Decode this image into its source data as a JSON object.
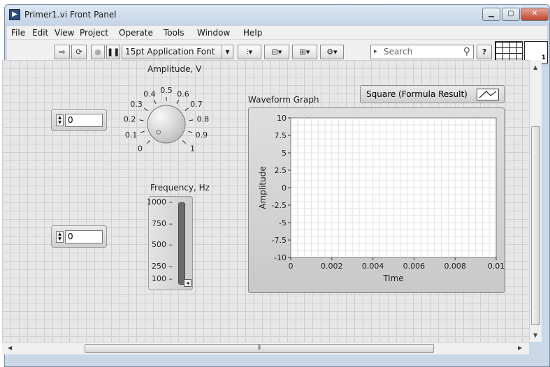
{
  "window": {
    "title": "Primer1.vi Front Panel"
  },
  "menu": [
    "File",
    "Edit",
    "View",
    "Project",
    "Operate",
    "Tools",
    "Window",
    "Help"
  ],
  "toolbar": {
    "font": "15pt Application Font",
    "search_placeholder": "Search",
    "vi_icon_badge": "1"
  },
  "controls": {
    "numeric1_value": "0",
    "numeric2_value": "0",
    "knob": {
      "label": "Amplitude, V",
      "min": 0,
      "max": 1,
      "value": 0,
      "ticks": [
        "0",
        "0.1",
        "0.2",
        "0.3",
        "0.4",
        "0.5",
        "0.6",
        "0.7",
        "0.8",
        "0.9",
        "1"
      ]
    },
    "slider": {
      "label": "Frequency, Hz",
      "ticks": [
        "1000",
        "750",
        "500",
        "250",
        "100"
      ],
      "min": 100,
      "max": 1000,
      "value": 100
    }
  },
  "graph": {
    "title": "Waveform Graph",
    "legend": "Square (Formula Result)",
    "xlabel": "Time",
    "ylabel": "Amplitude",
    "xticks": [
      "0",
      "0.002",
      "0.004",
      "0.006",
      "0.008",
      "0.01"
    ],
    "yticks": [
      "10",
      "7.5",
      "5",
      "2.5",
      "0",
      "-2.5",
      "-5",
      "-7.5",
      "-10"
    ]
  },
  "colors": {
    "panel_grid": "#cfcfcf",
    "panel_bg": "#e7e7e7",
    "plot_grid": "#e2e2e2",
    "slider_fill": "#6b6b6b"
  }
}
